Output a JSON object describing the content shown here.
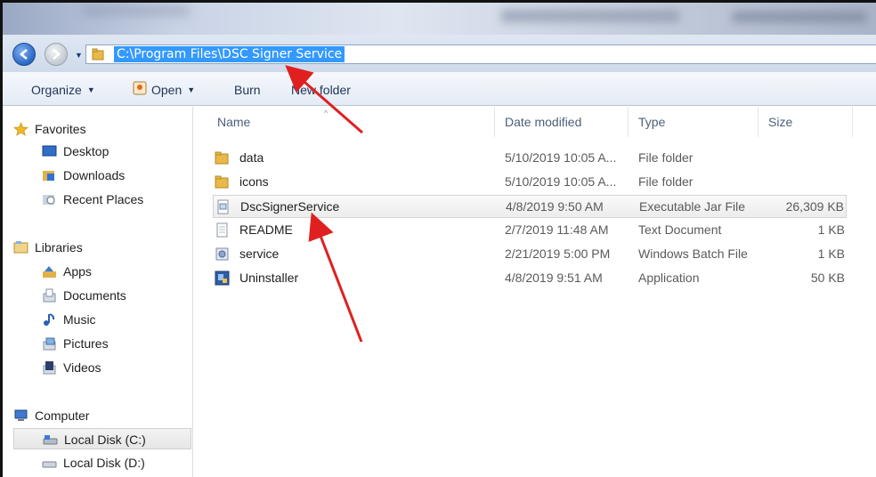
{
  "address": {
    "path": "C:\\Program Files\\DSC Signer Service"
  },
  "toolbar": {
    "organize": "Organize",
    "open": "Open",
    "burn": "Burn",
    "new_folder": "New folder"
  },
  "nav": {
    "favorites": "Favorites",
    "desktop": "Desktop",
    "downloads": "Downloads",
    "recent": "Recent Places",
    "libraries": "Libraries",
    "apps": "Apps",
    "documents": "Documents",
    "music": "Music",
    "pictures": "Pictures",
    "videos": "Videos",
    "computer": "Computer",
    "disk_c": "Local Disk (C:)",
    "disk_d": "Local Disk (D:)"
  },
  "columns": {
    "name": "Name",
    "date": "Date modified",
    "type": "Type",
    "size": "Size"
  },
  "files": [
    {
      "name": "data",
      "date": "5/10/2019 10:05 A...",
      "type": "File folder",
      "size": "",
      "icon": "folder-icon"
    },
    {
      "name": "icons",
      "date": "5/10/2019 10:05 A...",
      "type": "File folder",
      "size": "",
      "icon": "folder-icon"
    },
    {
      "name": "DscSignerService",
      "date": "4/8/2019 9:50 AM",
      "type": "Executable Jar File",
      "size": "26,309 KB",
      "icon": "jar-file-icon"
    },
    {
      "name": "README",
      "date": "2/7/2019 11:48 AM",
      "type": "Text Document",
      "size": "1 KB",
      "icon": "text-file-icon"
    },
    {
      "name": "service",
      "date": "2/21/2019 5:00 PM",
      "type": "Windows Batch File",
      "size": "1 KB",
      "icon": "batch-file-icon"
    },
    {
      "name": "Uninstaller",
      "date": "4/8/2019 9:51 AM",
      "type": "Application",
      "size": "50 KB",
      "icon": "app-icon"
    }
  ],
  "colors": {
    "selection": "#3399ff",
    "arrow": "#e02020",
    "toolbar_text": "#1e3557"
  }
}
